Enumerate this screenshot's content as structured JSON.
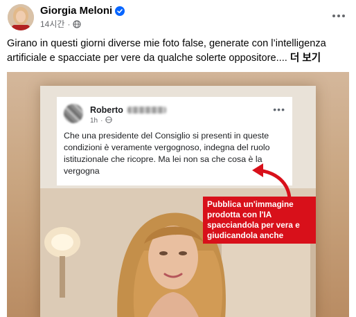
{
  "post": {
    "author": "Giorgia Meloni",
    "timestamp": "14시간",
    "separator": "·",
    "caption": "Girano in questi giorni diverse mie foto false, generate con l’intelligenza artificiale e spacciate per vere da qualche solerte oppositore.... ",
    "see_more": "더 보기"
  },
  "image": {
    "fake_post": {
      "author_name": "Roberto",
      "time": "1h",
      "separator": "·",
      "more": "•••",
      "text": "Che una presidente del Consiglio  si presenti in queste condizioni è veramente vergognoso, indegna del ruolo istituzionale che ricopre. Ma lei non sa che cosa è la vergogna"
    },
    "callout_text": "Pubblica un'immagine prodotta con l'IA spacciandola per vera e giudicandola anche"
  },
  "colors": {
    "verified": "#0866ff",
    "callout": "#d8101a",
    "muted_text": "#65676b"
  },
  "icons": [
    "verified-badge-icon",
    "globe-icon",
    "more-options-icon"
  ]
}
